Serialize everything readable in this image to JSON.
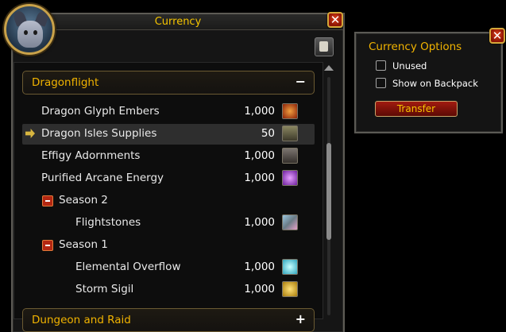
{
  "window": {
    "title": "Currency"
  },
  "header": {
    "label": "Dragonflight",
    "toggle": "−"
  },
  "header2": {
    "label": "Dungeon and Raid",
    "toggle": "+"
  },
  "rows": [
    {
      "name": "Dragon Glyph Embers",
      "amount": "1,000",
      "icon": "glyph-ember-icon",
      "color": "#c2401a"
    },
    {
      "name": "Dragon Isles Supplies",
      "amount": "50",
      "icon": "supplies-crate-icon",
      "color": "#6d6a4d"
    },
    {
      "name": "Effigy Adornments",
      "amount": "1,000",
      "icon": "effigy-icon",
      "color": "#5b5550"
    },
    {
      "name": "Purified Arcane Energy",
      "amount": "1,000",
      "icon": "arcane-orb-icon",
      "color": "#8a3bb8"
    }
  ],
  "season2": {
    "label": "Season 2",
    "items": [
      {
        "name": "Flightstones",
        "amount": "1,000",
        "icon": "flightstone-icon",
        "color": "#6a7c86"
      }
    ]
  },
  "season1": {
    "label": "Season 1",
    "items": [
      {
        "name": "Elemental Overflow",
        "amount": "1,000",
        "icon": "elemental-overflow-icon",
        "color": "#3fb6c6"
      },
      {
        "name": "Storm Sigil",
        "amount": "1,000",
        "icon": "storm-sigil-icon",
        "color": "#c9a019"
      }
    ]
  },
  "options": {
    "title": "Currency Options",
    "unused_label": "Unused",
    "backpack_label": "Show on Backpack",
    "transfer_label": "Transfer"
  }
}
